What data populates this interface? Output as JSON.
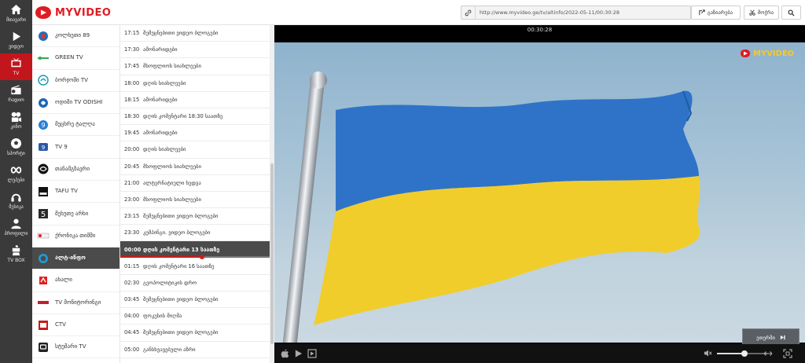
{
  "colors": {
    "brand_red": "#c3161c",
    "rail_bg": "#3a3a3a",
    "selected_bg": "#4b4b4b"
  },
  "rail": [
    {
      "label": "მთავარი",
      "icon": "home-icon"
    },
    {
      "label": "ვიდეო",
      "icon": "play-icon"
    },
    {
      "label": "TV",
      "icon": "tv-icon",
      "active": true
    },
    {
      "label": "რადიო",
      "icon": "radio-icon"
    },
    {
      "label": "კინო",
      "icon": "film-reel-icon"
    },
    {
      "label": "სპორტი",
      "icon": "soccer-ball-icon"
    },
    {
      "label": "ლუპები",
      "icon": "loop-icon"
    },
    {
      "label": "მუსიკა",
      "icon": "headphones-icon"
    },
    {
      "label": "პროფილი",
      "icon": "user-icon"
    },
    {
      "label": "TV BOX",
      "icon": "tvbox-icon"
    }
  ],
  "header": {
    "logo_text": "MYVIDEO",
    "url": "http://www.myvideo.ge/tv/altinfo/2022-05-11/00:30:28",
    "share_label": "გაზიარება",
    "cut_label": "მოჭრა"
  },
  "channels": [
    {
      "name": "კოლხეთი 89"
    },
    {
      "name": "GREEN TV"
    },
    {
      "name": "ბორჯომი TV"
    },
    {
      "name": "ოდიში TV ODISHI"
    },
    {
      "name": "მეცხრე ტალღა"
    },
    {
      "name": "TV 9"
    },
    {
      "name": "თანამგზავრი"
    },
    {
      "name": "TAFU TV"
    },
    {
      "name": "მეხუთე არხი"
    },
    {
      "name": "ქრონიკა თიმში"
    },
    {
      "name": "ალტ-ინფო",
      "active": true
    },
    {
      "name": "ახალი"
    },
    {
      "name": "TV მონიტორინგი"
    },
    {
      "name": "CTV"
    },
    {
      "name": "სტუმარი TV"
    }
  ],
  "schedule": [
    {
      "time": "17:15",
      "title": "შემეცნებითი ვიდეო ბლოგები"
    },
    {
      "time": "17:30",
      "title": "ამონარიდები"
    },
    {
      "time": "17:45",
      "title": "მსოფლიოს სიახლეები"
    },
    {
      "time": "18:00",
      "title": "დღის სიახლეები"
    },
    {
      "time": "18:15",
      "title": "ამონარიდები"
    },
    {
      "time": "18:30",
      "title": "დღის კომენტარი 18:30 საათზე"
    },
    {
      "time": "19:45",
      "title": "ამონარიდები"
    },
    {
      "time": "20:00",
      "title": "დღის სიახლეები"
    },
    {
      "time": "20:45",
      "title": "მსოფლიოს სიახლეები"
    },
    {
      "time": "21:00",
      "title": "ალტერნატიული ხედვა"
    },
    {
      "time": "23:00",
      "title": "მსოფლიოს სიახლეები"
    },
    {
      "time": "23:15",
      "title": "შემეცნებითი ვიდეო ბლოგები"
    },
    {
      "time": "23:30",
      "title": "კემპინგი. ვიდეო ბლოგები"
    },
    {
      "time": "00:00",
      "title": "დღის კომენტარი 13 საათზე",
      "current": true
    },
    {
      "time": "01:15",
      "title": "დღის კომენტარი 16 საათზე"
    },
    {
      "time": "02:30",
      "title": "გეოპოლიტიკის დრო"
    },
    {
      "time": "03:45",
      "title": "შემეცნებითი ვიდეო ბლოგები"
    },
    {
      "time": "04:00",
      "title": "ფოკუსის მიღმა"
    },
    {
      "time": "04:45",
      "title": "შემეცნებითი ვიდეო ბლოგები"
    },
    {
      "time": "05:00",
      "title": "განსხვავებული აზრი"
    }
  ],
  "player": {
    "timecode": "00:30:28",
    "watermark": "MYVIDEO",
    "go_live_label": "ეთერში",
    "volume_level": 0.55
  }
}
